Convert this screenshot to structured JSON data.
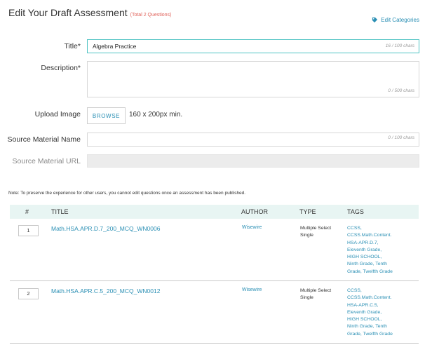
{
  "header": {
    "title": "Edit Your Draft Assessment",
    "subtitle": "(Total 2 Questions)",
    "edit_categories": "Edit Categories"
  },
  "form": {
    "title_label": "Title*",
    "title_value": "Algebra Practice",
    "title_count": "16 / 100 chars",
    "description_label": "Description*",
    "description_count": "0 / 500 chars",
    "upload_label": "Upload Image",
    "browse_label": "BROWSE",
    "upload_hint": "160 x 200px min.",
    "source_name_label": "Source Material Name",
    "source_name_count": "0 / 100 chars",
    "source_url_label": "Source Material URL"
  },
  "note": "Note: To preserve the experience for other users, you cannot edit questions once an assessment has been published.",
  "table": {
    "headers": {
      "num": "#",
      "title": "TITLE",
      "author": "AUTHOR",
      "type": "TYPE",
      "tags": "TAGS"
    },
    "rows": [
      {
        "num": "1",
        "title": "Math.HSA.APR.D.7_200_MCQ_WN0006",
        "author": "Wisewire",
        "type": "Multiple Select Single",
        "tags": [
          "CCSS,",
          "CCSS.Math.Content.",
          "HSA-APR.D.7,",
          "Eleventh Grade,",
          "HIGH SCHOOL,",
          "Ninth Grade, Tenth",
          "Grade, Twelfth Grade"
        ]
      },
      {
        "num": "2",
        "title": "Math.HSA.APR.C.5_200_MCQ_WN0012",
        "author": "Wisewire",
        "type": "Multiple Select Single",
        "tags": [
          "CCSS,",
          "CCSS.Math.Content.",
          "HSA-APR.C.5,",
          "Eleventh Grade,",
          "HIGH SCHOOL,",
          "Ninth Grade, Tenth",
          "Grade, Twelfth Grade"
        ]
      }
    ]
  },
  "colors": {
    "link": "#2a8fb4",
    "accent_border": "#4fc3c3",
    "table_header_bg": "#e8f5f3",
    "subtitle": "#e0625a"
  },
  "icons": {
    "edit_categories": "tag-icon"
  }
}
